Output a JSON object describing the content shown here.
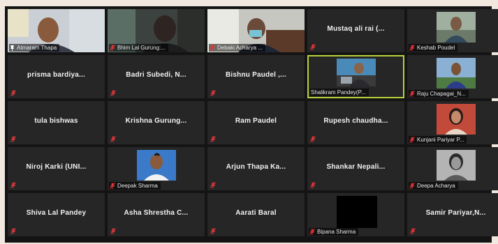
{
  "participants": [
    {
      "name": "Atmaram Thapa",
      "mode": "video"
    },
    {
      "name": "Bhim Lal Gurung:...",
      "mode": "video"
    },
    {
      "name": "Debaki Acharya ...",
      "mode": "video"
    },
    {
      "name": "Mustaq ali rai (...",
      "mode": "label"
    },
    {
      "name": "Keshab Poudel",
      "mode": "photo"
    },
    {
      "name": "prisma bardiya...",
      "mode": "label"
    },
    {
      "name": "Badri Subedi, N...",
      "mode": "label"
    },
    {
      "name": "Bishnu Paudel ,...",
      "mode": "label"
    },
    {
      "name": "Shalikram Pandey(P...",
      "mode": "photo"
    },
    {
      "name": "Raju Chapagai_N...",
      "mode": "photo"
    },
    {
      "name": "tula bishwas",
      "mode": "label"
    },
    {
      "name": "Krishna Gurung...",
      "mode": "label"
    },
    {
      "name": "Ram Paudel",
      "mode": "label"
    },
    {
      "name": "Rupesh chaudha...",
      "mode": "label"
    },
    {
      "name": "Kunjani Pariyar P...",
      "mode": "photo"
    },
    {
      "name": "Niroj Karki (UNI...",
      "mode": "label"
    },
    {
      "name": "Deepak Sharma",
      "mode": "photo"
    },
    {
      "name": "Arjun Thapa Ka...",
      "mode": "label"
    },
    {
      "name": "Shankar Nepali...",
      "mode": "label"
    },
    {
      "name": "Deepa Acharya",
      "mode": "photo"
    },
    {
      "name": "Shiva Lal Pandey",
      "mode": "label"
    },
    {
      "name": "Asha Shrestha C...",
      "mode": "label"
    },
    {
      "name": "Aarati Baral",
      "mode": "label"
    },
    {
      "name": "Bipana Sharma",
      "mode": "photo"
    },
    {
      "name": "Samir Pariyar,N...",
      "mode": "label"
    }
  ],
  "active_speaker_index": 8,
  "colors": {
    "active_border": "#b8d33a",
    "mute": "#e0353a",
    "tile_bg": "#262626"
  }
}
